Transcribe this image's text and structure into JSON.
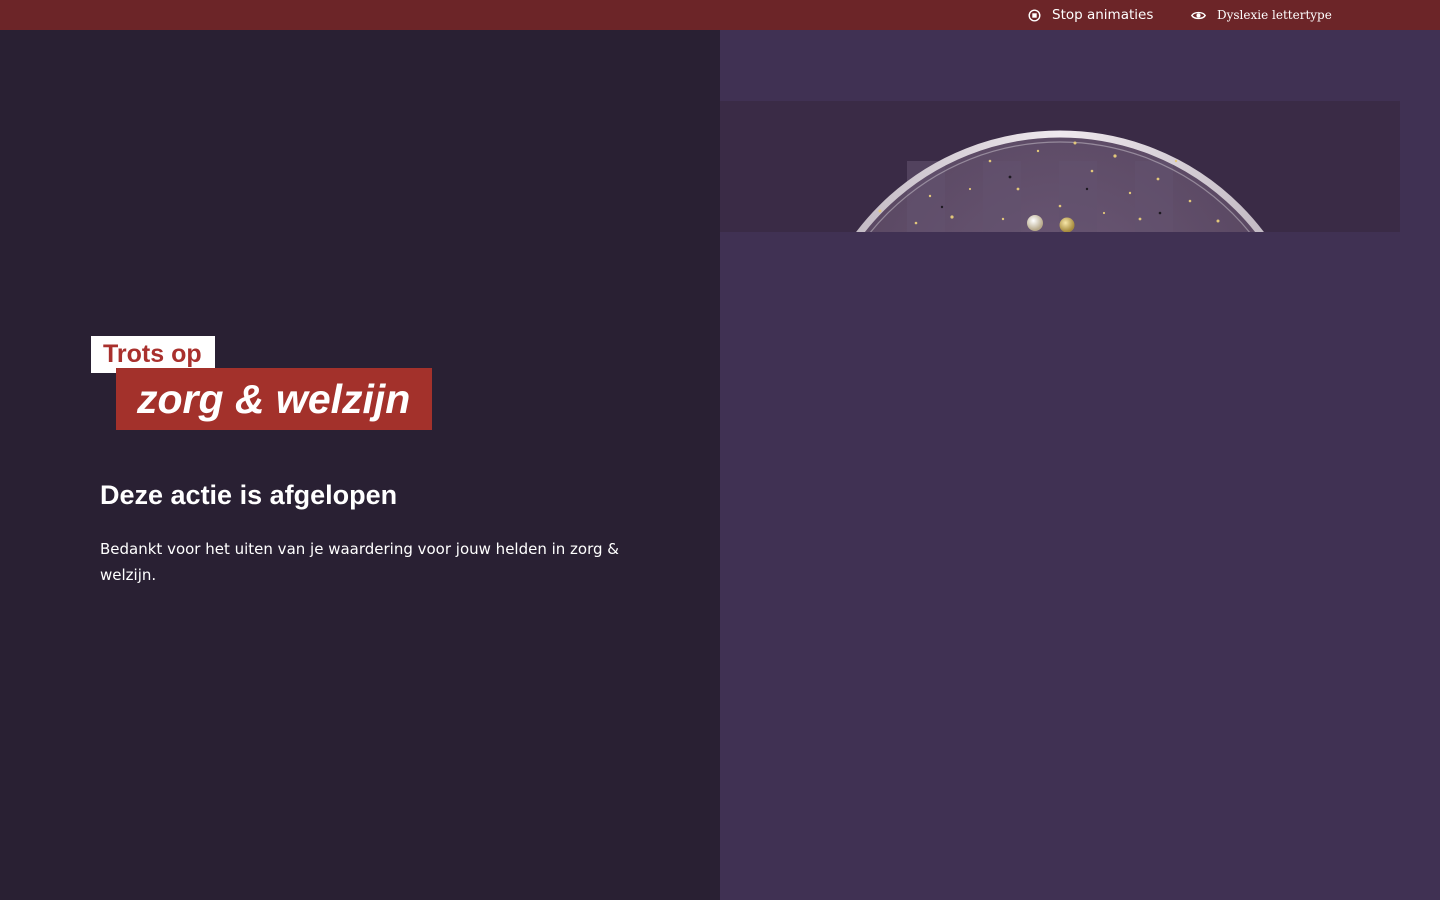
{
  "topbar": {
    "stop_animations_label": "Stop animaties",
    "stop_icon": "stop-circle-icon",
    "dyslexia_font_label": "Dyslexie lettertype",
    "dyslexia_icon": "eye-icon",
    "background_color": "#6c2528"
  },
  "hero": {
    "tag_small": "Trots op",
    "tag_big": "zorg & welzijn",
    "heading": "Deze actie is afgelopen",
    "body": "Bedankt voor het uiten van je waardering voor jouw helden in zorg & welzijn."
  },
  "colors": {
    "left_background": "#292033",
    "right_background": "#403153",
    "accent_red": "#a3312b",
    "text": "#ffffff"
  }
}
